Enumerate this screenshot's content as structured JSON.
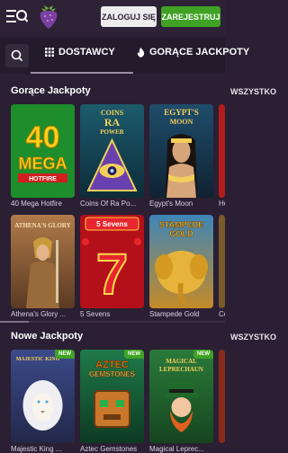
{
  "header": {
    "login_label": "ZALOGUJ SIĘ",
    "register_label": "ZAREJESTRUJ"
  },
  "nav": {
    "tabs": [
      {
        "label": "DOSTAWCY",
        "icon": "grid-icon"
      },
      {
        "label": "GORĄCE JACKPOTY",
        "icon": "flame-icon"
      }
    ]
  },
  "hot_jackpots": {
    "title": "Gorące Jackpoty",
    "all_label": "WSZYSTKO",
    "games": [
      {
        "caption": "40 Mega Hotfire"
      },
      {
        "caption": "Coins Of Ra Po..."
      },
      {
        "caption": "Egypt's Moon"
      },
      {
        "caption": "He..."
      },
      {
        "caption": "Athena's Glory ..."
      },
      {
        "caption": "5 Sevens"
      },
      {
        "caption": "Stampede Gold"
      },
      {
        "caption": "Ce..."
      }
    ]
  },
  "new_jackpots": {
    "title": "Nowe Jackpoty",
    "all_label": "WSZYSTKO",
    "badge": "NEW",
    "games": [
      {
        "caption": "Majestic King ..."
      },
      {
        "caption": "Aztec Gemstones"
      },
      {
        "caption": "Magical Leprec..."
      }
    ]
  },
  "tile_art": {
    "t1": {
      "line1": "40",
      "line2": "MEGA",
      "line3": "HOTFIRE"
    },
    "t2": {
      "line1": "COINS",
      "line2": "RA",
      "line3": "POWER"
    },
    "t3": {
      "line1": "EGYPT'S",
      "line2": "MOON"
    },
    "t5": {
      "line1": "ATHENA'S GLORY"
    },
    "t6": {
      "line1": "5 Sevens"
    },
    "t7": {
      "line1": "STAMPEDE",
      "line2": "GOLD"
    },
    "n1": {
      "line1": "MAJESTIC KING"
    },
    "n2": {
      "line1": "AZTEC",
      "line2": "GEMSTONES"
    },
    "n3": {
      "line1": "MAGICAL",
      "line2": "LEPRECHAUN"
    }
  },
  "colors": {
    "background": "#2a1f33",
    "accent_green": "#3fa224",
    "login_bg": "#ecebee"
  }
}
